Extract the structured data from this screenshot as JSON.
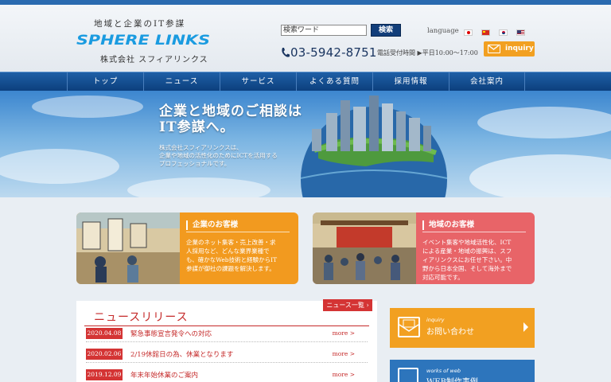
{
  "header": {
    "tagline": "地域と企業のIT参謀",
    "logo_text": "SPHERE LINKS",
    "company": "株式会社 スフィアリンクス",
    "search_placeholder": "検索ワード",
    "search_button": "検索",
    "language_label": "language",
    "phone": "03-5942-8751",
    "hours": "電話受付時間 ▶平日10:00〜17:00",
    "inquiry_button": "inquiry"
  },
  "nav": {
    "items": [
      {
        "label": "トップ"
      },
      {
        "label": "ニュース"
      },
      {
        "label": "サービス"
      },
      {
        "label": "よくある質問"
      },
      {
        "label": "採用情報"
      },
      {
        "label": "会社案内"
      }
    ]
  },
  "hero": {
    "title_line1": "企業と地域のご相談は",
    "title_line2": "IT参謀へ。",
    "desc_line1": "株式会社スフィアリンクスは、",
    "desc_line2": "企業や地域の活性化のためにICTを活用する",
    "desc_line3": "プロフェッショナルです。"
  },
  "cards": {
    "business": {
      "title": "企業のお客様",
      "lines": [
        "企業のネット集客・売上改善・求",
        "人採用など、どんな業界業種で",
        "も、確かなWeb技術と経験からIT",
        "参謀が御社の課題を解決します。"
      ],
      "color": "#f29a1f"
    },
    "region": {
      "title": "地域のお客様",
      "lines": [
        "イベント集客や地域活性化、ICT",
        "による産業・地域の振興は、スフ",
        "ィアリンクスにお任せ下さい。中",
        "野から日本全国、そして海外まで",
        "対応可能です。"
      ],
      "color": "#e86468"
    }
  },
  "news": {
    "title": "ニュースリリース",
    "list_button": "ニュース一覧 ›",
    "items": [
      {
        "date": "2020.04.08",
        "text": "緊急事態宣言発令への対応",
        "more": "more >"
      },
      {
        "date": "2020.02.06",
        "text": "2/19休館日の為、休業となります",
        "more": "more >"
      },
      {
        "date": "2019.12.09",
        "text": "年末年始休業のご案内",
        "more": "more >"
      }
    ]
  },
  "side": {
    "inquiry_en": "inquiry",
    "inquiry_jp": "お問い合わせ",
    "web_en": "works of web",
    "web_jp": "WEB制作事例"
  }
}
